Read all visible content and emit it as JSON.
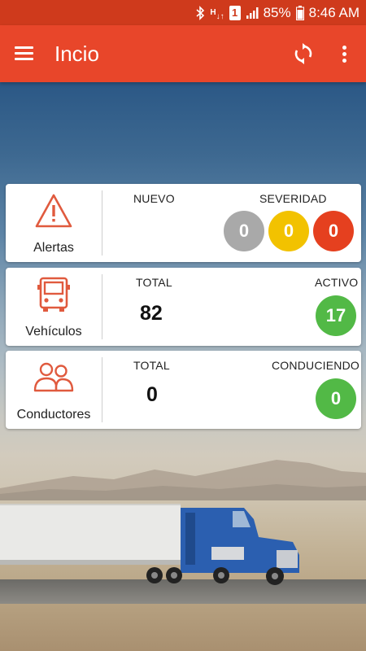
{
  "status_bar": {
    "battery": "85%",
    "time": "8:46 AM",
    "sim_label": "1",
    "network_label": "H"
  },
  "app_bar": {
    "title": "Incio"
  },
  "alerts_card": {
    "label": "Alertas",
    "new_header": "NUEVO",
    "severity_header": "SEVERIDAD",
    "severity": [
      {
        "value": "0",
        "color": "#a9a9a9"
      },
      {
        "value": "0",
        "color": "#f2c200"
      },
      {
        "value": "0",
        "color": "#e5401f"
      }
    ]
  },
  "vehicles_card": {
    "label": "Vehículos",
    "total_header": "TOTAL",
    "total_value": "82",
    "active_header": "ACTIVO",
    "active_value": "17",
    "active_color": "#52b946"
  },
  "drivers_card": {
    "label": "Conductores",
    "total_header": "TOTAL",
    "total_value": "0",
    "driving_header": "CONDUCIENDO",
    "driving_value": "0",
    "driving_color": "#52b946"
  },
  "colors": {
    "accent": "#e8462a",
    "status_bar": "#cf3a1c",
    "icon": "#e05a3e"
  }
}
